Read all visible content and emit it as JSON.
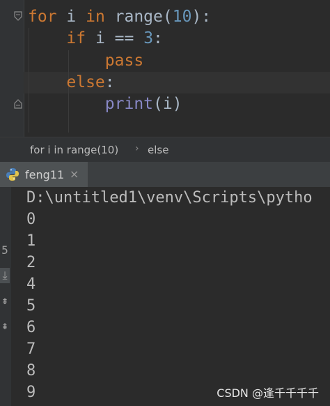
{
  "editor": {
    "lines": [
      {
        "parts": [
          {
            "t": "for",
            "c": "kw"
          },
          {
            "t": " i ",
            "c": ""
          },
          {
            "t": "in",
            "c": "kw"
          },
          {
            "t": " range(",
            "c": ""
          },
          {
            "t": "10",
            "c": "num"
          },
          {
            "t": "):",
            "c": ""
          }
        ]
      },
      {
        "parts": [
          {
            "t": "    ",
            "c": ""
          },
          {
            "t": "if",
            "c": "kw"
          },
          {
            "t": " i == ",
            "c": ""
          },
          {
            "t": "3",
            "c": "num"
          },
          {
            "t": ":",
            "c": ""
          }
        ]
      },
      {
        "parts": [
          {
            "t": "        ",
            "c": ""
          },
          {
            "t": "pass",
            "c": "kw"
          }
        ]
      },
      {
        "parts": [
          {
            "t": "    ",
            "c": ""
          },
          {
            "t": "else",
            "c": "kw"
          },
          {
            "t": ":",
            "c": ""
          }
        ]
      },
      {
        "parts": [
          {
            "t": "        ",
            "c": ""
          },
          {
            "t": "print",
            "c": "fn"
          },
          {
            "t": "(i)",
            "c": ""
          }
        ]
      }
    ]
  },
  "breadcrumb": {
    "item1": "for i in range(10)",
    "sep": "›",
    "item2": "else"
  },
  "run_tab": {
    "label": "feng11",
    "close": "×"
  },
  "console": {
    "command": "D:\\untitled1\\venv\\Scripts\\pytho",
    "outputs": [
      "0",
      "1",
      "2",
      "4",
      "5",
      "6",
      "7",
      "8",
      "9"
    ]
  },
  "side_tools": [
    "5",
    "⤓",
    "⇟",
    "⇞"
  ],
  "watermark": "CSDN @逢千千千千"
}
